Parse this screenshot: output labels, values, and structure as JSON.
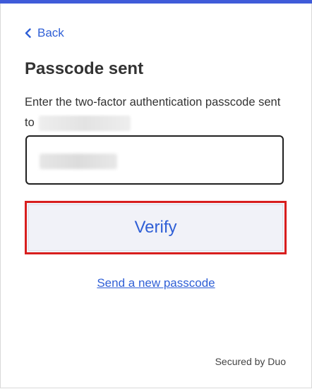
{
  "colors": {
    "accent": "#3f5bd9",
    "link": "#2f5fd6",
    "highlight_border": "#d81e1e",
    "text": "#333333"
  },
  "back": {
    "label": "Back",
    "icon": "chevron-left-icon"
  },
  "title": "Passcode sent",
  "description": {
    "text": "Enter the two-factor authentication passcode sent to"
  },
  "passcode_field": {
    "value": ""
  },
  "verify_button": {
    "label": "Verify"
  },
  "resend_link": {
    "label": "Send a new passcode"
  },
  "footer": {
    "secured_by": "Secured by Duo"
  }
}
